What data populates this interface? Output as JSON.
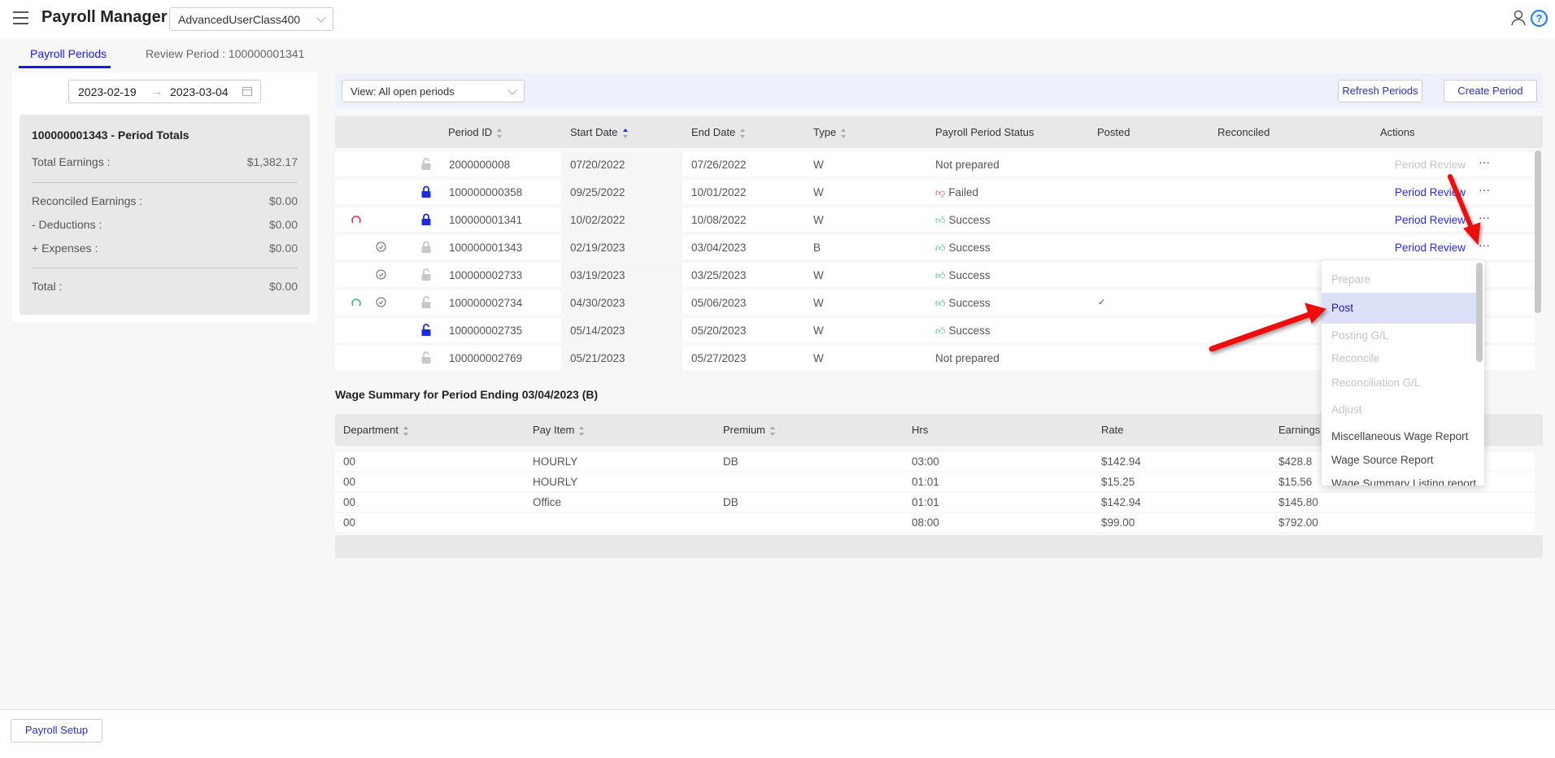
{
  "header": {
    "title": "Payroll Manager",
    "class_select": "AdvancedUserClass400",
    "icons": [
      "menu-icon",
      "user-icon",
      "help-icon"
    ]
  },
  "tabs": [
    {
      "label": "Payroll Periods",
      "active": true
    },
    {
      "label": "Review Period : 100000001341"
    }
  ],
  "date_range": {
    "start": "2023-02-19",
    "end": "2023-03-04"
  },
  "totals": {
    "title": "100000001343 - Period Totals",
    "total_earnings_label": "Total Earnings :",
    "total_earnings": "$1,382.17",
    "reconciled_label": "Reconciled Earnings :",
    "reconciled": "$0.00",
    "deductions_label": "- Deductions :",
    "deductions": "$0.00",
    "expenses_label": "+ Expenses :",
    "expenses": "$0.00",
    "total_label": "Total :",
    "total": "$0.00"
  },
  "toolbar": {
    "view_select": "View: All open periods",
    "refresh": "Refresh Periods",
    "create": "Create Period"
  },
  "periods": {
    "columns": [
      "Period ID",
      "Start Date",
      "End Date",
      "Type",
      "Payroll Period Status",
      "Posted",
      "Reconciled",
      "Actions"
    ],
    "rows": [
      {
        "sync": "",
        "check": false,
        "lock": "unlocked-gray",
        "id": "2000000008",
        "start": "07/20/2022",
        "end": "07/26/2022",
        "type": "W",
        "status": "Not prepared",
        "status_icon": "",
        "posted": "",
        "action": "Period Review",
        "action_enabled": false
      },
      {
        "sync": "",
        "check": false,
        "lock": "locked-blue",
        "id": "100000000358",
        "start": "09/25/2022",
        "end": "10/01/2022",
        "type": "W",
        "status": "Failed",
        "status_icon": "thumbs-down",
        "posted": "",
        "action": "Period Review",
        "action_enabled": true
      },
      {
        "sync": "red",
        "check": false,
        "lock": "locked-blue",
        "id": "100000001341",
        "start": "10/02/2022",
        "end": "10/08/2022",
        "type": "W",
        "status": "Success",
        "status_icon": "thumbs-up",
        "posted": "",
        "action": "Period Review",
        "action_enabled": true
      },
      {
        "sync": "",
        "check": true,
        "lock": "locked-gray",
        "id": "100000001343",
        "start": "02/19/2023",
        "end": "03/04/2023",
        "type": "B",
        "status": "Success",
        "status_icon": "thumbs-up",
        "posted": "",
        "action": "Period Review",
        "action_enabled": true
      },
      {
        "sync": "",
        "check": true,
        "lock": "unlocked-gray",
        "id": "100000002733",
        "start": "03/19/2023",
        "end": "03/25/2023",
        "type": "W",
        "status": "Success",
        "status_icon": "thumbs-up",
        "posted": "",
        "action": "",
        "action_enabled": false
      },
      {
        "sync": "green",
        "check": true,
        "lock": "unlocked-gray",
        "id": "100000002734",
        "start": "04/30/2023",
        "end": "05/06/2023",
        "type": "W",
        "status": "Success",
        "status_icon": "thumbs-up",
        "posted": "✓",
        "action": "",
        "action_enabled": false
      },
      {
        "sync": "",
        "check": false,
        "lock": "unlocked-blue",
        "id": "100000002735",
        "start": "05/14/2023",
        "end": "05/20/2023",
        "type": "W",
        "status": "Success",
        "status_icon": "thumbs-up",
        "posted": "",
        "action": "",
        "action_enabled": false
      },
      {
        "sync": "",
        "check": false,
        "lock": "unlocked-gray",
        "id": "100000002769",
        "start": "05/21/2023",
        "end": "05/27/2023",
        "type": "W",
        "status": "Not prepared",
        "status_icon": "",
        "posted": "",
        "action": "",
        "action_enabled": false
      }
    ]
  },
  "wage_summary": {
    "title": "Wage Summary for Period Ending 03/04/2023 (B)",
    "columns": [
      "Department",
      "Pay Item",
      "Premium",
      "Hrs",
      "Rate",
      "Earnings"
    ],
    "rows": [
      [
        "00",
        "HOURLY",
        "DB",
        "03:00",
        "$142.94",
        "$428.8"
      ],
      [
        "00",
        "HOURLY",
        "",
        "01:01",
        "$15.25",
        "$15.56"
      ],
      [
        "00",
        "Office",
        "DB",
        "01:01",
        "$142.94",
        "$145.80"
      ],
      [
        "00",
        "",
        "",
        "08:00",
        "$99.00",
        "$792.00"
      ]
    ]
  },
  "action_menu": {
    "items": [
      {
        "label": "Prepare",
        "enabled": false
      },
      {
        "label": "Post",
        "enabled": true,
        "highlighted": true
      },
      {
        "label": "Posting G/L",
        "enabled": false
      },
      {
        "label": "Reconcile",
        "enabled": false
      },
      {
        "label": "Reconciliation G/L",
        "enabled": false
      },
      {
        "label": "Adjust",
        "enabled": false
      },
      {
        "label": "Miscellaneous Wage Report",
        "enabled": true
      },
      {
        "label": "Wage Source Report",
        "enabled": true
      },
      {
        "label": "Wage Summary Listing report",
        "enabled": true
      }
    ]
  },
  "footer": {
    "setup": "Payroll Setup"
  },
  "colors": {
    "accent": "#2a2ae0",
    "success": "#2fbf71",
    "failed": "#e8334a",
    "annotation_arrow": "#ee1111"
  }
}
